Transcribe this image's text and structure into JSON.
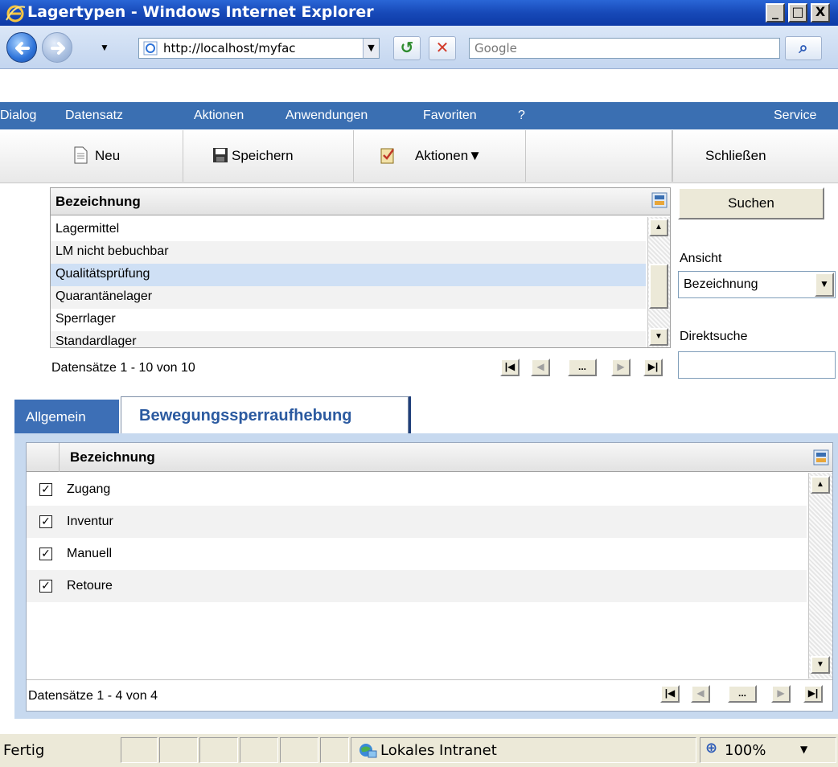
{
  "window": {
    "title": "Lagertypen - Windows Internet Explorer",
    "controls": [
      "_",
      "□",
      "X"
    ]
  },
  "addressbar": {
    "url": "http://localhost/myfac",
    "search_placeholder": "Google"
  },
  "menu": {
    "items": [
      {
        "label": "Dialog"
      },
      {
        "label": "Datensatz"
      },
      {
        "label": "Aktionen"
      },
      {
        "label": "Anwendungen"
      },
      {
        "label": "Favoriten"
      },
      {
        "label": "?"
      }
    ],
    "right_label": "Service"
  },
  "toolbar": {
    "new_label": "Neu",
    "save_label": "Speichern",
    "actions_label": "Aktionen▼",
    "close_label": "Schließen"
  },
  "list": {
    "header": "Bezeichnung",
    "rows": [
      "Lagermittel",
      "LM nicht bebuchbar",
      "Qualitätsprüfung",
      "Quarantänelager",
      "Sperrlager",
      "Standardlager"
    ],
    "selected_index": 2,
    "footer": "Datensätze 1 - 10 von 10"
  },
  "side": {
    "search_button": "Suchen",
    "view_label": "Ansicht",
    "view_value": "Bezeichnung",
    "direct_label": "Direktsuche",
    "direct_value": ""
  },
  "tabs": {
    "general": "Allgemein",
    "active": "Bewegungssperraufhebung"
  },
  "detail": {
    "header": "Bezeichnung",
    "rows": [
      {
        "label": "Zugang",
        "checked": true
      },
      {
        "label": "Inventur",
        "checked": true
      },
      {
        "label": "Manuell",
        "checked": true
      },
      {
        "label": "Retoure",
        "checked": true
      }
    ],
    "footer": "Datensätze 1 - 4 von 4"
  },
  "pager": {
    "first": "|◀",
    "prev": "◀",
    "more": "...",
    "next": "▶",
    "last": "▶|"
  },
  "status": {
    "text": "Fertig",
    "zone": "Lokales Intranet",
    "zoom": "100%"
  },
  "colors": {
    "menu_bg": "#3a6fb2",
    "selected_row": "#cfe0f5",
    "panel_bg": "#c7d9ef",
    "tab_active_text": "#2b5aa0"
  }
}
